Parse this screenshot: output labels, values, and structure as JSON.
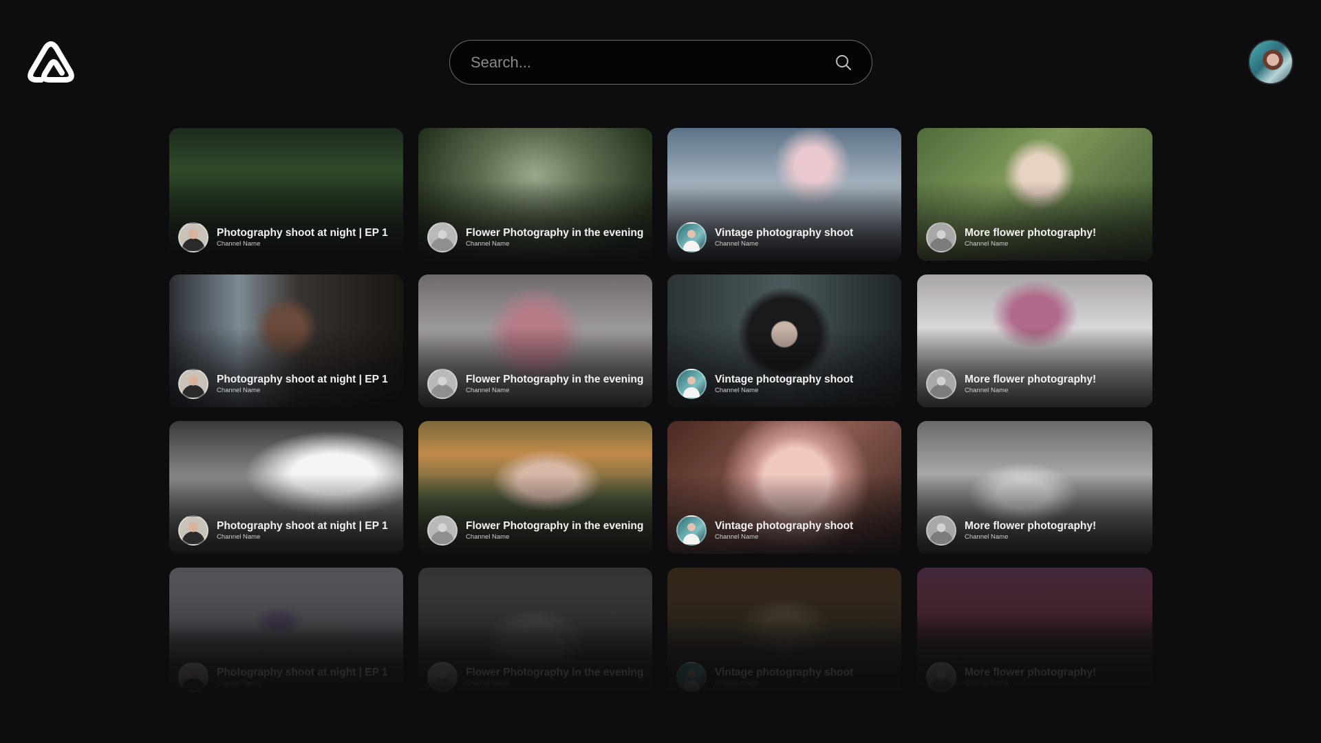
{
  "app": {
    "brand": "logo",
    "accent": "#ffffff",
    "background": "#0d0d0f"
  },
  "search": {
    "placeholder": "Search...",
    "icon": "search-icon"
  },
  "profile": {
    "icon": "user-avatar"
  },
  "videos": [
    {
      "title": "Photography shoot at night | EP 1",
      "channel": "Channel Name",
      "thumb": "forest-pond",
      "avatar": "a"
    },
    {
      "title": "Flower Photography in the evening",
      "channel": "Channel Name",
      "thumb": "misty-forest",
      "avatar": "b"
    },
    {
      "title": "Vintage photography shoot",
      "channel": "Channel Name",
      "thumb": "cherry-blossom",
      "avatar": "c"
    },
    {
      "title": "More flower photography!",
      "channel": "Channel Name",
      "thumb": "blonde-leaves",
      "avatar": "d"
    },
    {
      "title": "Photography shoot at night | EP 1",
      "channel": "Channel Name",
      "thumb": "masked-woman",
      "avatar": "a"
    },
    {
      "title": "Flower Photography in the evening",
      "channel": "Channel Name",
      "thumb": "pink-branches",
      "avatar": "b"
    },
    {
      "title": "Vintage photography shoot",
      "channel": "Channel Name",
      "thumb": "dark-hair-woman",
      "avatar": "c"
    },
    {
      "title": "More flower photography!",
      "channel": "Channel Name",
      "thumb": "pink-tree",
      "avatar": "d"
    },
    {
      "title": "Photography shoot at night | EP 1",
      "channel": "Channel Name",
      "thumb": "bw-clouds",
      "avatar": "a"
    },
    {
      "title": "Flower Photography in the evening",
      "channel": "Channel Name",
      "thumb": "woman-grass",
      "avatar": "b"
    },
    {
      "title": "Vintage photography shoot",
      "channel": "Channel Name",
      "thumb": "pink-rose",
      "avatar": "c"
    },
    {
      "title": "More flower photography!",
      "channel": "Channel Name",
      "thumb": "bw-mountains",
      "avatar": "d"
    },
    {
      "title": "Photography shoot at night | EP 1",
      "channel": "Channel Name",
      "thumb": "lavender-stem",
      "avatar": "a"
    },
    {
      "title": "Flower Photography in the evening",
      "channel": "Channel Name",
      "thumb": "bw-peaks",
      "avatar": "b"
    },
    {
      "title": "Vintage photography shoot",
      "channel": "Channel Name",
      "thumb": "van-interior",
      "avatar": "c"
    },
    {
      "title": "More flower photography!",
      "channel": "Channel Name",
      "thumb": "dusk-hills",
      "avatar": "d"
    }
  ]
}
